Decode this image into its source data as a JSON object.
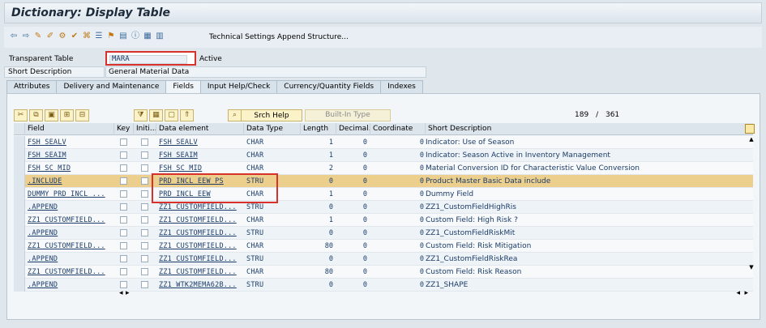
{
  "window": {
    "title": "Dictionary: Display Table"
  },
  "toolbar": {
    "icons": [
      "back-arrow-icon",
      "forward-arrow-icon",
      "other-object-icon",
      "display-change-icon",
      "activate-icon",
      "check-icon",
      "where-used-icon",
      "object-list-icon",
      "navigation-icon",
      "hierarchy-icon",
      "info-icon",
      "table-contents-icon",
      "layout-icon"
    ],
    "technical_settings_label": "Technical Settings",
    "append_structure_label": "Append Structure..."
  },
  "header": {
    "table_type_label": "Transparent Table",
    "table_name": "MARA",
    "status": "Active",
    "short_description_label": "Short Description",
    "short_description": "General Material Data"
  },
  "tabs": [
    {
      "label": "Attributes"
    },
    {
      "label": "Delivery and Maintenance"
    },
    {
      "label": "Fields"
    },
    {
      "label": "Input Help/Check"
    },
    {
      "label": "Currency/Quantity Fields"
    },
    {
      "label": "Indexes"
    }
  ],
  "grid_controls": {
    "search_help_label": "Srch Help",
    "built_in_type_label": "Built-In Type",
    "counter_current": "189",
    "counter_sep": "/",
    "counter_total": "361"
  },
  "columns": {
    "field": "Field",
    "key": "Key",
    "initial": "Initi...",
    "data_element": "Data element",
    "data_type": "Data Type",
    "length": "Length",
    "decimal": "Decimal...",
    "coordinate": "Coordinate",
    "short_description": "Short Description"
  },
  "rows": [
    {
      "field": "FSH_SEALV",
      "data_element": "FSH_SEALV",
      "data_type": "CHAR",
      "length": "1",
      "decimal": "0",
      "coordinate": "0",
      "desc": "Indicator: Use of Season"
    },
    {
      "field": "FSH_SEAIM",
      "data_element": "FSH_SEAIM",
      "data_type": "CHAR",
      "length": "1",
      "decimal": "0",
      "coordinate": "0",
      "desc": "Indicator: Season Active in Inventory Management"
    },
    {
      "field": "FSH_SC_MID",
      "data_element": "FSH_SC_MID",
      "data_type": "CHAR",
      "length": "2",
      "decimal": "0",
      "coordinate": "0",
      "desc": "Material Conversion ID for Characteristic Value Conversion"
    },
    {
      "field": ".INCLUDE",
      "data_element": "PRD_INCL_EEW_PS",
      "data_type": "STRU",
      "length": "0",
      "decimal": "0",
      "coordinate": "0",
      "desc": "Product Master Basic Data include"
    },
    {
      "field": "DUMMY_PRD_INCL_...",
      "data_element": "PRD_INCL_EEW",
      "data_type": "CHAR",
      "length": "1",
      "decimal": "0",
      "coordinate": "0",
      "desc": "Dummy Field"
    },
    {
      "field": ".APPEND",
      "data_element": "ZZ1_CUSTOMFIELD...",
      "data_type": "STRU",
      "length": "0",
      "decimal": "0",
      "coordinate": "0",
      "desc": "ZZ1_CustomFieldHighRis"
    },
    {
      "field": "ZZ1_CUSTOMFIELD...",
      "data_element": "ZZ1_CUSTOMFIELD...",
      "data_type": "CHAR",
      "length": "1",
      "decimal": "0",
      "coordinate": "0",
      "desc": "Custom Field: High Risk ?"
    },
    {
      "field": ".APPEND",
      "data_element": "ZZ1_CUSTOMFIELD...",
      "data_type": "STRU",
      "length": "0",
      "decimal": "0",
      "coordinate": "0",
      "desc": "ZZ1_CustomFieldRiskMit"
    },
    {
      "field": "ZZ1_CUSTOMFIELD...",
      "data_element": "ZZ1_CUSTOMFIELD...",
      "data_type": "CHAR",
      "length": "80",
      "decimal": "0",
      "coordinate": "0",
      "desc": "Custom Field: Risk Mitigation"
    },
    {
      "field": ".APPEND",
      "data_element": "ZZ1_CUSTOMFIELD...",
      "data_type": "STRU",
      "length": "0",
      "decimal": "0",
      "coordinate": "0",
      "desc": "ZZ1_CustomFieldRiskRea"
    },
    {
      "field": "ZZ1_CUSTOMFIELD...",
      "data_element": "ZZ1_CUSTOMFIELD...",
      "data_type": "CHAR",
      "length": "80",
      "decimal": "0",
      "coordinate": "0",
      "desc": "Custom Field: Risk Reason"
    },
    {
      "field": ".APPEND",
      "data_element": "ZZ1_WTK2MEMA62B...",
      "data_type": "STRU",
      "length": "0",
      "decimal": "0",
      "coordinate": "0",
      "desc": "ZZ1_SHAPE"
    }
  ],
  "highlight_row_index": 3,
  "colors": {
    "highlight_row": "#eccf8c",
    "annotation_box": "#d8302a",
    "link_text": "#1b3c69"
  }
}
